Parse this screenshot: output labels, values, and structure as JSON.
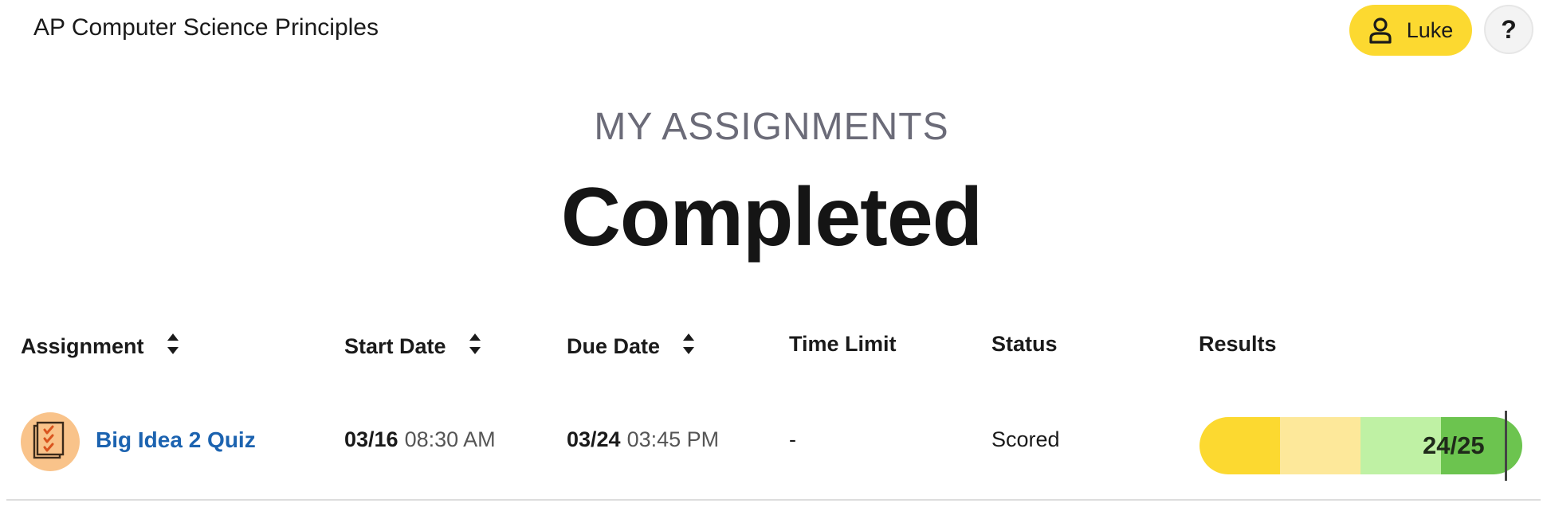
{
  "header": {
    "course_title": "AP Computer Science Principles",
    "user_name": "Luke",
    "help_label": "?"
  },
  "page": {
    "eyebrow": "MY ASSIGNMENTS",
    "title": "Completed"
  },
  "table": {
    "columns": [
      {
        "label": "Assignment",
        "sortable": true
      },
      {
        "label": "Start Date",
        "sortable": true
      },
      {
        "label": "Due Date",
        "sortable": true
      },
      {
        "label": "Time Limit",
        "sortable": false
      },
      {
        "label": "Status",
        "sortable": false
      },
      {
        "label": "Results",
        "sortable": false
      }
    ],
    "rows": [
      {
        "icon": "quiz-checklist-icon",
        "assignment": "Big Idea 2 Quiz",
        "start_date": "03/16",
        "start_time": "08:30 AM",
        "due_date": "03/24",
        "due_time": "03:45 PM",
        "time_limit": "-",
        "status": "Scored",
        "result": "24/25",
        "result_fraction": 0.96
      }
    ]
  },
  "colors": {
    "accent_yellow": "#fcd930",
    "link_blue": "#1c63b0",
    "result_segments": [
      "#fcd930",
      "#fde89a",
      "#bff1a4",
      "#6cc44f"
    ]
  }
}
